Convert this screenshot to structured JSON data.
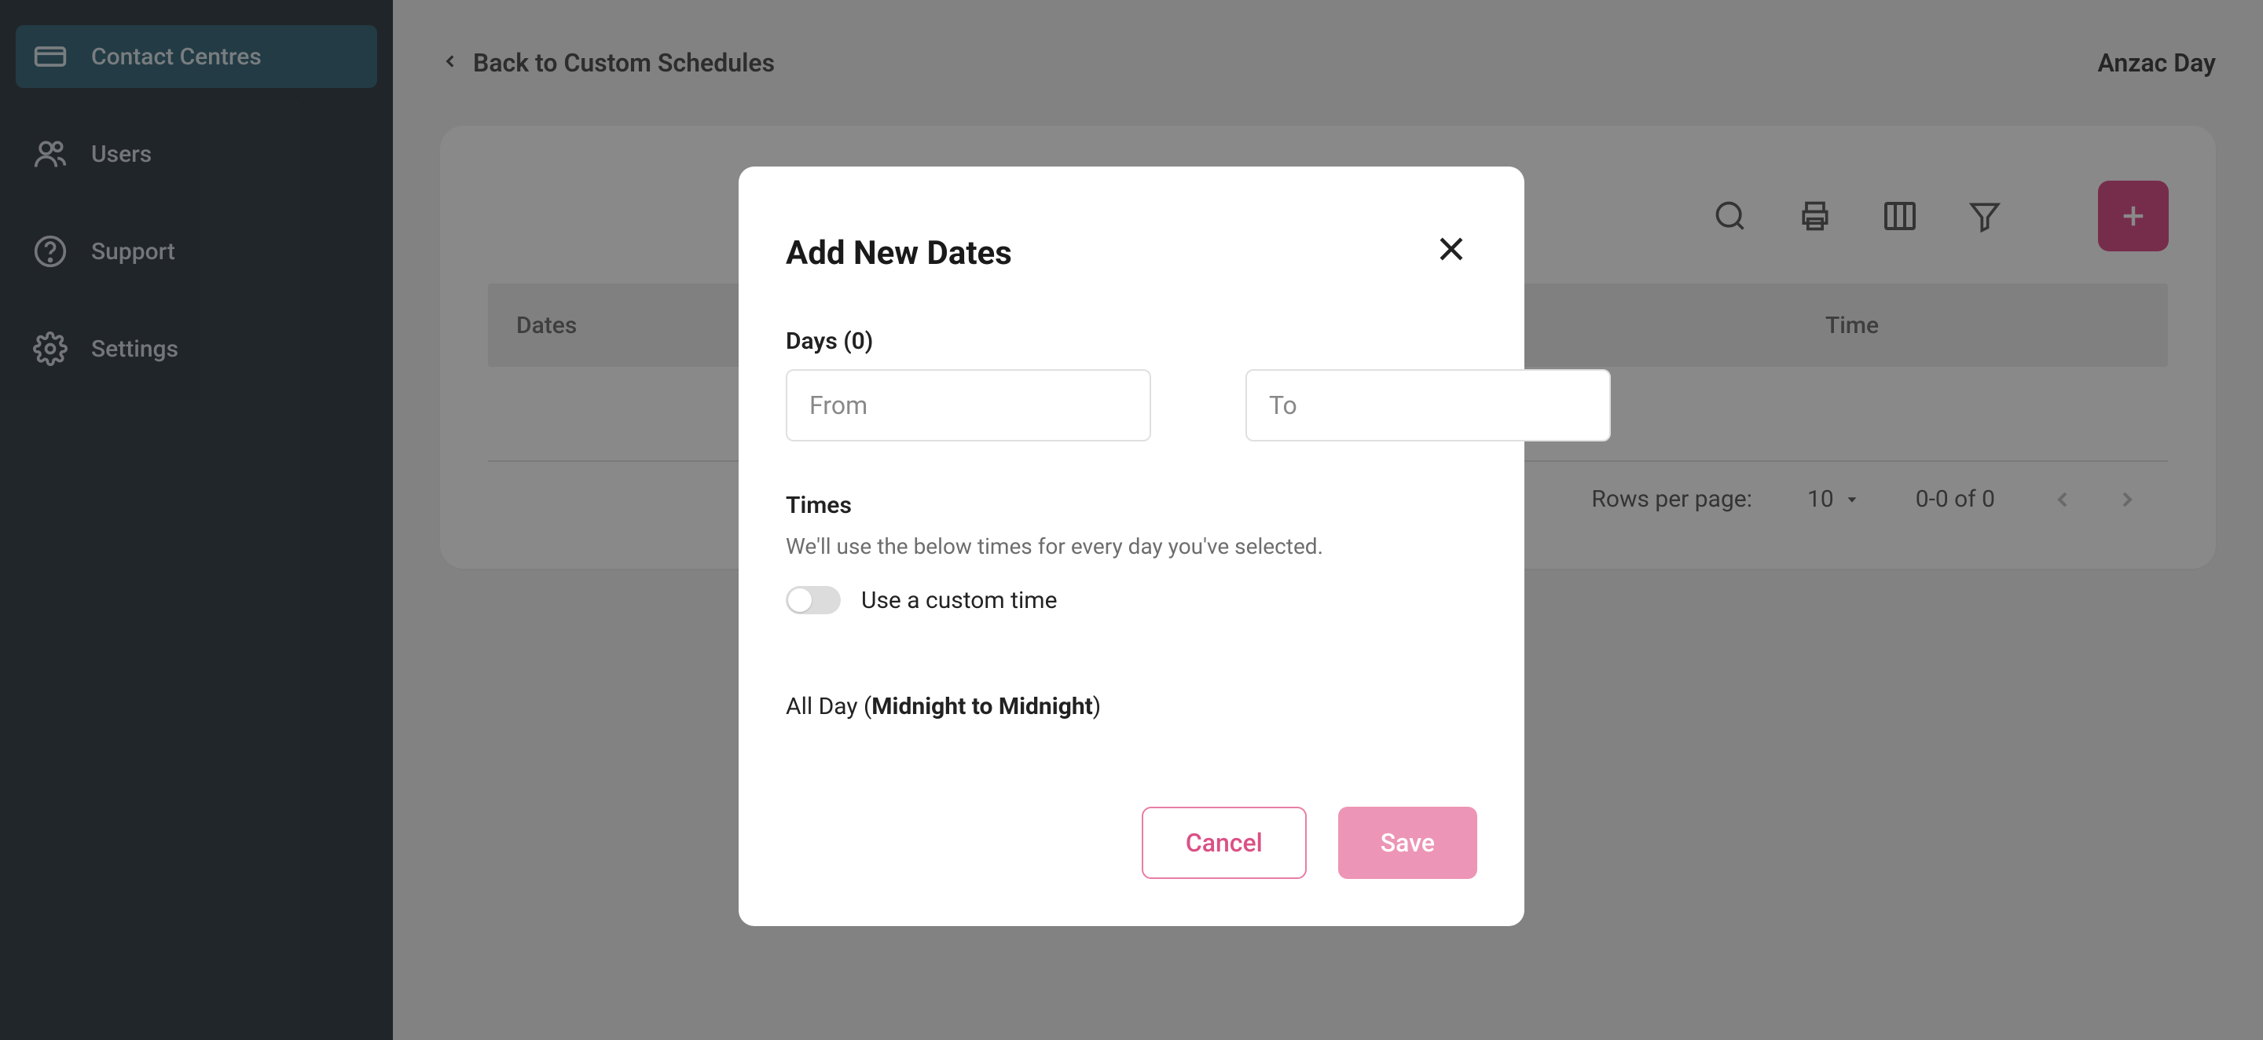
{
  "sidebar": {
    "items": [
      {
        "label": "Contact Centres",
        "icon": "contact-centres-icon"
      },
      {
        "label": "Users",
        "icon": "users-icon"
      },
      {
        "label": "Support",
        "icon": "support-icon"
      },
      {
        "label": "Settings",
        "icon": "settings-icon"
      }
    ]
  },
  "header": {
    "back_label": "Back to Custom Schedules",
    "page_title": "Anzac Day"
  },
  "table": {
    "columns": {
      "dates": "Dates",
      "time": "Time"
    },
    "footer": {
      "rows_label": "Rows per page:",
      "rows_value": "10",
      "range": "0-0 of 0"
    }
  },
  "dialog": {
    "title": "Add New Dates",
    "days_label": "Days (0)",
    "from_placeholder": "From",
    "to_placeholder": "To",
    "times_label": "Times",
    "times_sub": "We'll use the below times for every day you've selected.",
    "toggle_label": "Use a custom time",
    "allday_prefix": "All Day (",
    "allday_strong": "Midnight to Midnight",
    "allday_suffix": ")",
    "cancel": "Cancel",
    "save": "Save"
  }
}
